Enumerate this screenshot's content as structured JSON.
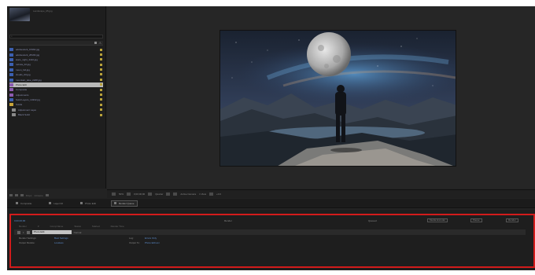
{
  "project": {
    "thumbnail_caption": "Landscape_05.jpg",
    "search_placeholder": "",
    "files": [
      {
        "name": "adobestock_15364.jpg",
        "color": "#3b5fb0",
        "label": "#b9a23a"
      },
      {
        "name": "adobestock_28193.jpg",
        "color": "#3b5fb0",
        "label": "#b9a23a"
      },
      {
        "name": "stars_night_4410.jpg",
        "color": "#3b5fb0",
        "label": "#b9a23a"
      },
      {
        "name": "nebula_02.jpg",
        "color": "#3b5fb0",
        "label": "#b9a23a"
      },
      {
        "name": "moon_full.jpg",
        "color": "#3b5fb0",
        "label": "#b9a23a"
      },
      {
        "name": "clouds_03.jpg",
        "color": "#3b5fb0",
        "label": "#b9a23a"
      },
      {
        "name": "mountain_lake_2208.jpg",
        "color": "#3b5fb0",
        "label": "#b9a23a"
      },
      {
        "name": "Photo Edit",
        "color": "#8c5bb0",
        "label": "#b9a23a",
        "selected": true
      },
      {
        "name": "Composite",
        "color": "#8c5bb0",
        "label": "#b9a23a"
      },
      {
        "name": "Adjustments",
        "color": "#8c5bb0",
        "label": "#b9a23a"
      },
      {
        "name": "Solid Layers_14332.jpg",
        "color": "#3b5fb0",
        "label": "#b9a23a"
      },
      {
        "name": "Solids",
        "color": "#c9a53a",
        "label": "#b9a23a",
        "folder": true
      },
      {
        "name": "Adjustment Layer",
        "color": "#8a8a8a",
        "label": "#b9a23a",
        "indent": true
      },
      {
        "name": "Black Solid",
        "color": "#8a8a8a",
        "label": "#b9a23a",
        "indent": true
      }
    ],
    "footer": {
      "bit_depth": "8 bpc",
      "count": "14 items"
    }
  },
  "viewer_toolbar": {
    "zoom": "50%",
    "timecode": "0;00;00;00",
    "resolution": "Quarter",
    "camera": "Active Camera",
    "views": "1 View",
    "exposure": "+0.0"
  },
  "tabs": [
    {
      "label": "Composite",
      "active": false
    },
    {
      "label": "Layer 02",
      "active": false
    },
    {
      "label": "Photo Edit",
      "active": false
    },
    {
      "label": "Render Queue",
      "active": true
    }
  ],
  "timeline": {
    "timecode": "0;00;00;00",
    "center_label": "Render",
    "right_label": "Queued",
    "buttons": [
      "Media Encoder",
      "Pause",
      "Render"
    ],
    "columns": [
      "Render",
      "#",
      "Comp Name",
      "Status",
      "Started",
      "Render Time"
    ],
    "layer": {
      "index": "1",
      "name": "Photo Edit",
      "mode": "Normal"
    },
    "properties": [
      {
        "label": "Render Settings:",
        "value": "Best Settings",
        "label2": "Log:",
        "value2": "Errors Only"
      },
      {
        "label": "Output Module:",
        "value": "Lossless",
        "label2": "Output To:",
        "value2": "Photo Edit.avi"
      }
    ]
  },
  "colors": {
    "highlight": "#d21b1b",
    "value_blue": "#5d8fd0",
    "panel_bg": "#232323"
  }
}
